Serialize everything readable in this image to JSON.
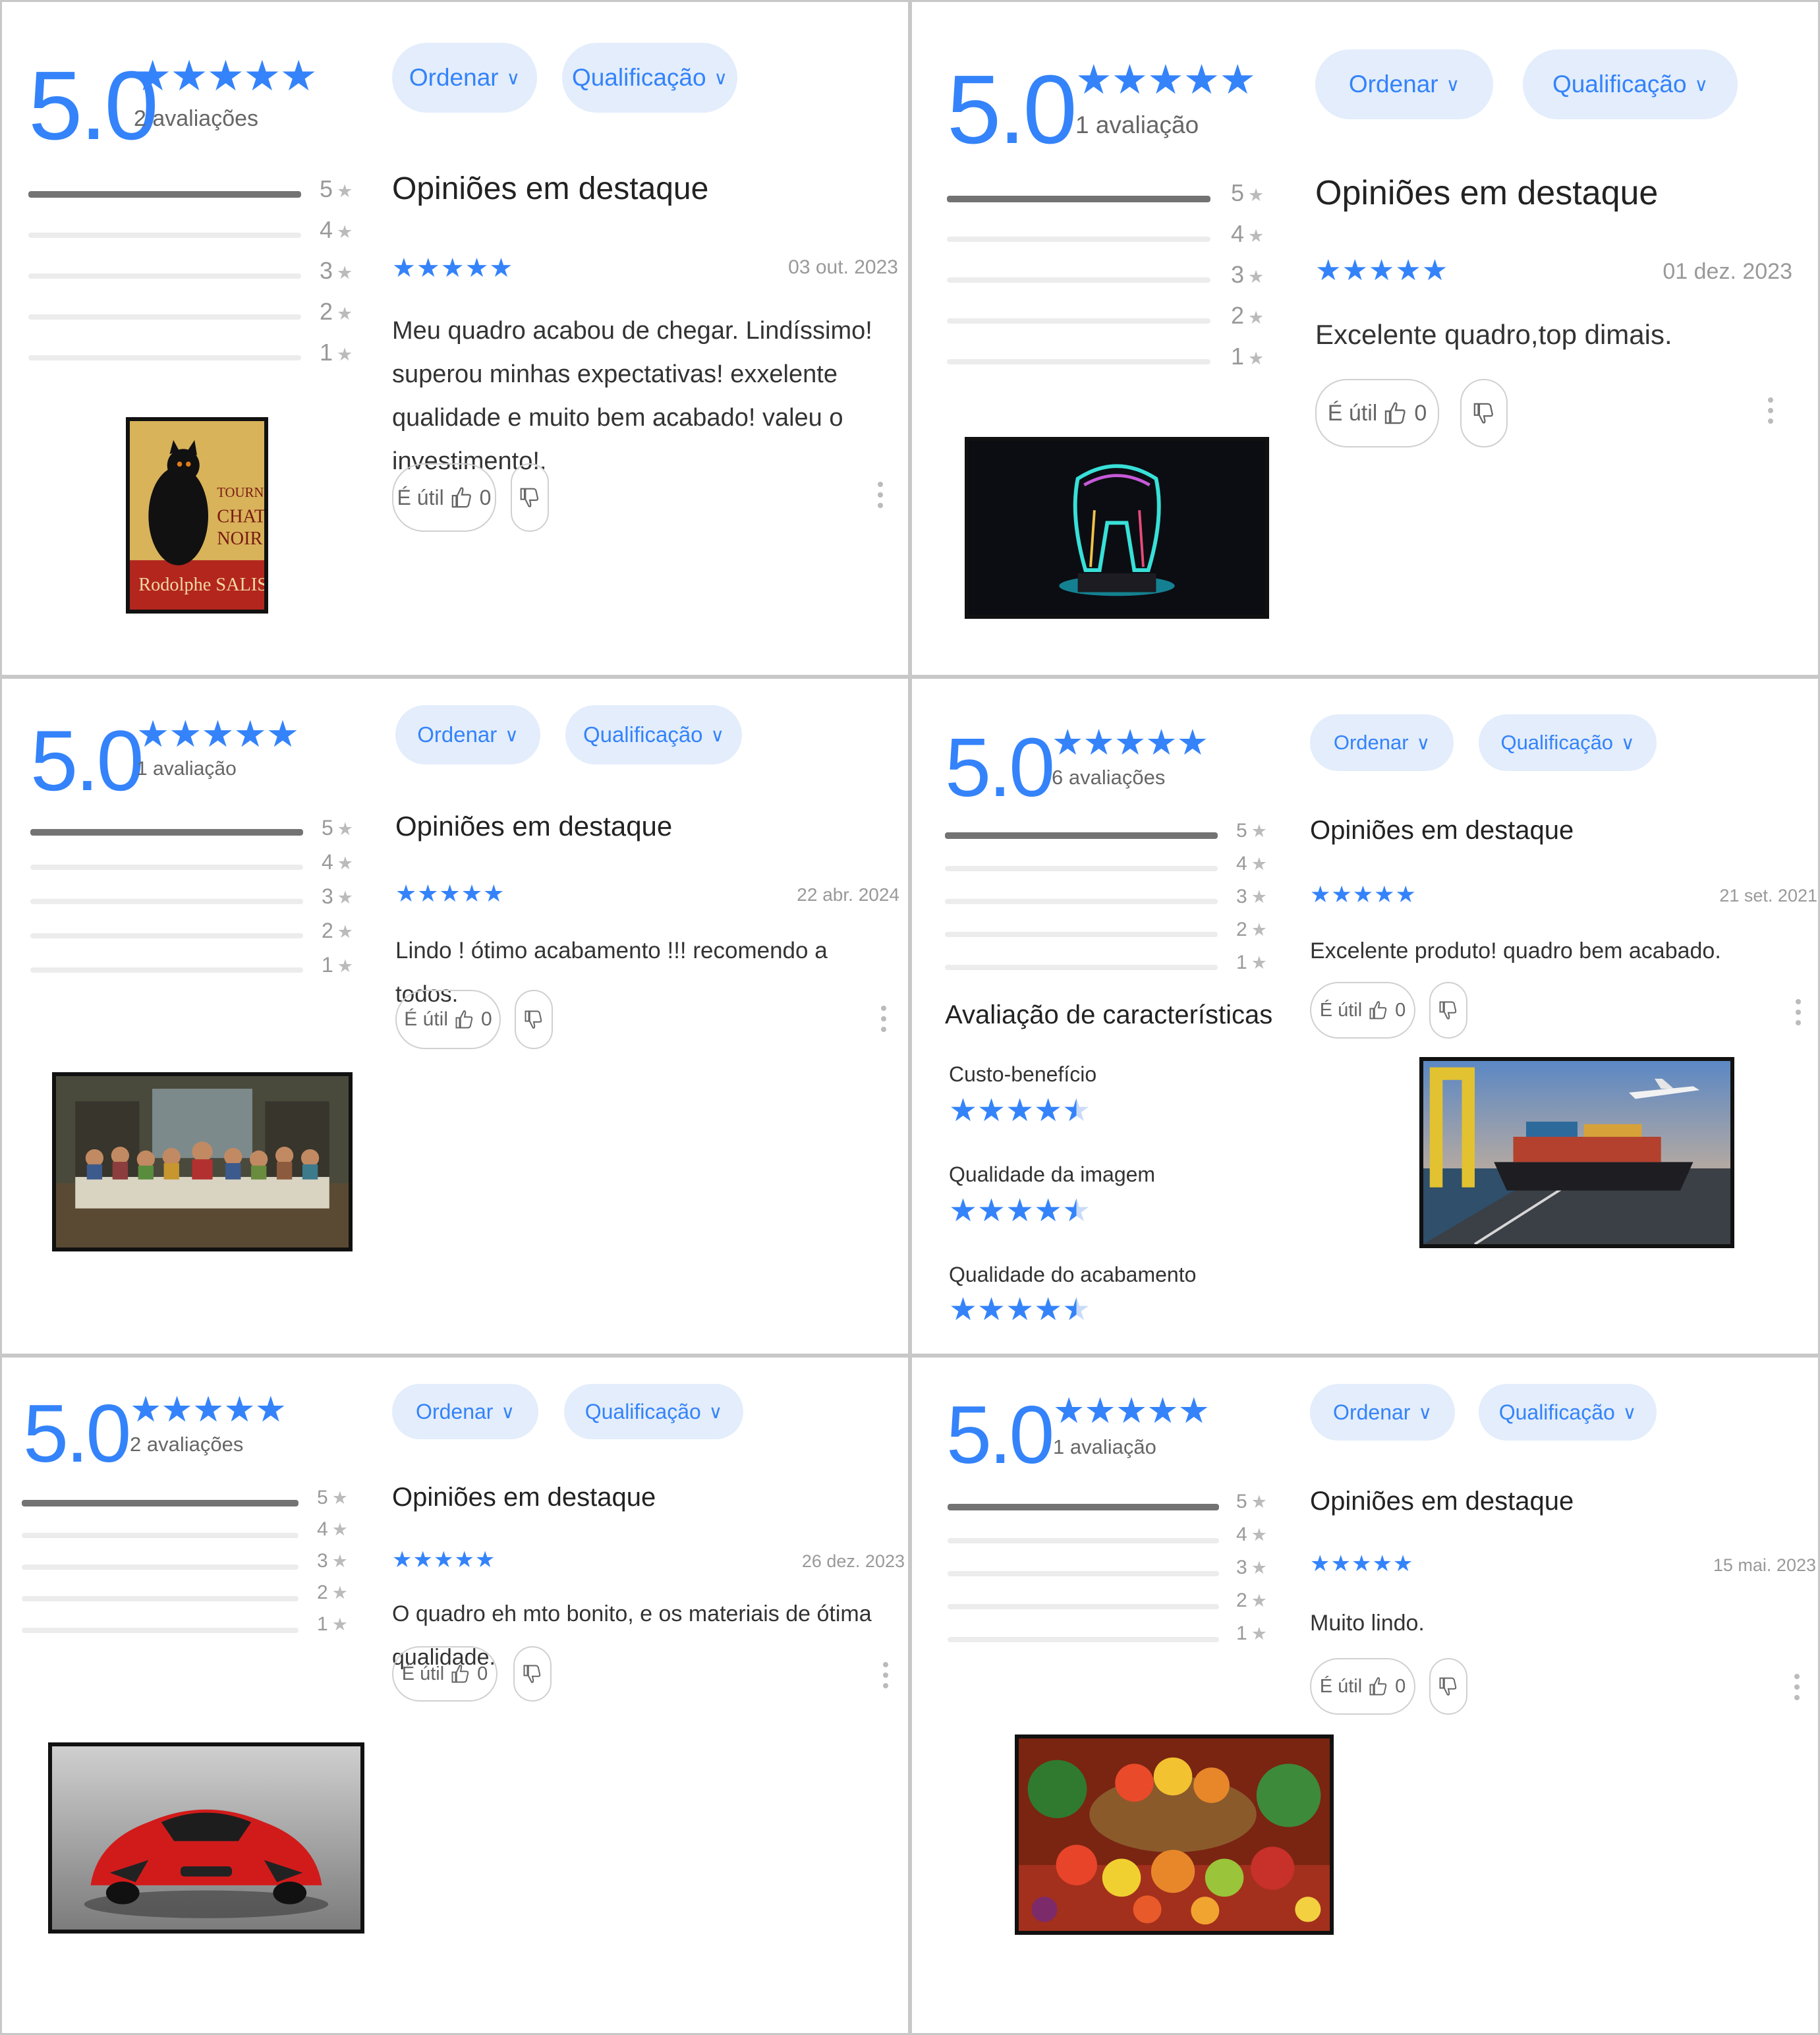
{
  "common": {
    "sort_label": "Ordenar",
    "rating_filter_label": "Qualificação",
    "featured_heading": "Opiniões em destaque",
    "helpful_label": "É útil",
    "helpful_count": "0",
    "star_glyph": "★",
    "chevron_glyph": "∨",
    "accent_color": "#3483fa",
    "histogram_labels": [
      "5",
      "4",
      "3",
      "2",
      "1"
    ]
  },
  "panels": [
    {
      "score": "5.0",
      "rating_count": "2 avaliações",
      "review_date": "03 out. 2023",
      "review_text": "Meu quadro acabou de chegar. Lindíssimo! superou minhas expectativas! exxelente qualidade e muito bem acabado! valeu o investimento!.",
      "photo": "poster-black-cat-tournee"
    },
    {
      "score": "5.0",
      "rating_count": "1 avaliação",
      "review_date": "01 dez. 2023",
      "review_text": "Excelente quadro,top dimais.",
      "photo": "neon-tooth-art"
    },
    {
      "score": "5.0",
      "rating_count": "1 avaliação",
      "review_date": "22 abr. 2024",
      "review_text": "Lindo ! ótimo acabamento !!! recomendo a todos.",
      "photo": "last-supper-painting"
    },
    {
      "score": "5.0",
      "rating_count": "6 avaliações",
      "review_date": "21 set. 2021",
      "review_text": "Excelente produto! quadro bem acabado.",
      "photo": "cargo-ship-port-airplane",
      "features_heading": "Avaliação de características",
      "features": [
        {
          "label": "Custo-benefício",
          "stars": 4.5
        },
        {
          "label": "Qualidade da imagem",
          "stars": 4.5
        },
        {
          "label": "Qualidade do acabamento",
          "stars": 4.5
        }
      ]
    },
    {
      "score": "5.0",
      "rating_count": "2 avaliações",
      "review_date": "26 dez. 2023",
      "review_text": "O quadro eh mto bonito, e os materiais de ótima qualidade.",
      "photo": "red-sports-car"
    },
    {
      "score": "5.0",
      "rating_count": "1 avaliação",
      "review_date": "15 mai. 2023",
      "review_text": "Muito lindo.",
      "photo": "fruit-basket"
    }
  ]
}
